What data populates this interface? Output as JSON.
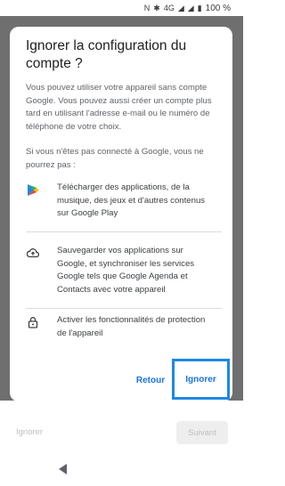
{
  "status_bar": {
    "battery_text": "100 %",
    "network_label": "4G"
  },
  "dialog": {
    "title": "Ignorer la configuration du compte ?",
    "paragraph_1": "Vous pouvez utiliser votre appareil sans compte Google. Vous pouvez aussi créer un compte plus tard en utilisant l'adresse e-mail ou le numéro de téléphone de votre choix.",
    "paragraph_2": "Si vous n'êtes pas connecté à Google, vous ne pourrez pas :",
    "features": [
      {
        "icon": "google-play-icon",
        "text": "Télécharger des applications, de la musique, des jeux et d'autres contenus sur Google Play"
      },
      {
        "icon": "cloud-upload-icon",
        "text": "Sauvegarder vos applications sur Google, et synchroniser les services Google tels que Google Agenda et Contacts avec votre appareil"
      },
      {
        "icon": "lock-icon",
        "text": "Activer les fonctionnalités de protection de l'appareil"
      }
    ],
    "back_label": "Retour",
    "skip_label": "Ignorer"
  },
  "background_page": {
    "skip_label": "Ignorer",
    "next_label": "Suivant"
  },
  "colors": {
    "accent": "#1a73e8",
    "highlight_border": "#1e88e5",
    "scrim": "#6f6f6f"
  }
}
